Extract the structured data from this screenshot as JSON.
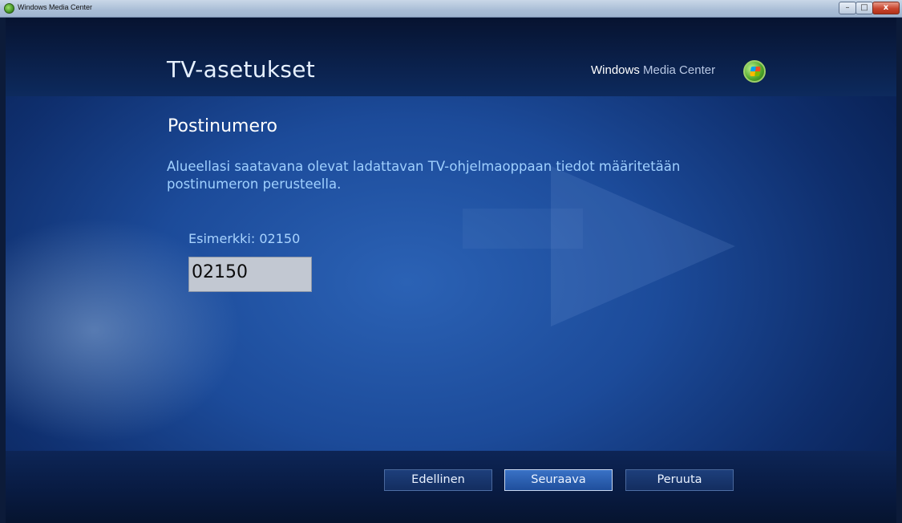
{
  "window": {
    "title": "Windows Media Center",
    "controls": {
      "minimize": "–",
      "maximize": "□",
      "close": "x"
    }
  },
  "header": {
    "title": "TV-asetukset",
    "brand_bold": "Windows",
    "brand_light": "Media Center"
  },
  "main": {
    "section_title": "Postinumero",
    "description": "Alueellasi saatavana olevat ladattavan TV-ohjelmaoppaan tiedot määritetään postinumeron perusteella.",
    "example_label": "Esimerkki: 02150",
    "postal_code_value": "02150"
  },
  "footer": {
    "buttons": {
      "previous": "Edellinen",
      "next": "Seuraava",
      "cancel": "Peruuta"
    },
    "focused_button": "next"
  },
  "colors": {
    "background_blue": "#1c4b9a",
    "title_text": "#e6f0ff",
    "description_text": "#9fd0ff"
  }
}
